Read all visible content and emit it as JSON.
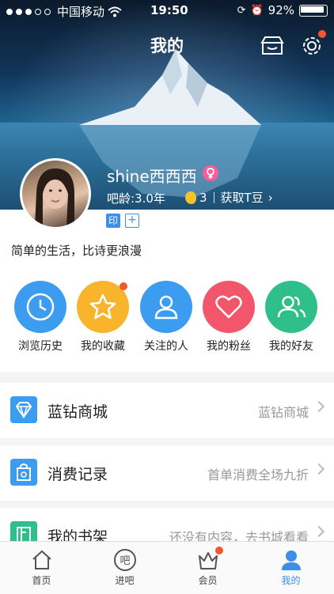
{
  "status": {
    "carrier": "中国移动",
    "time": "19:50",
    "battery": "92%"
  },
  "header": {
    "title": "我的"
  },
  "profile": {
    "username": "shine西西西",
    "age": "吧龄:3.0年",
    "beans_count": "3",
    "get_beans": "获取T豆",
    "badge_print": "印",
    "badge_add": "+",
    "bio": "简单的生活，比诗更浪漫"
  },
  "quick": [
    {
      "label": "浏览历史",
      "color": "#3c9df0"
    },
    {
      "label": "我的收藏",
      "color": "#f8b52b"
    },
    {
      "label": "关注的人",
      "color": "#3c9df0"
    },
    {
      "label": "我的粉丝",
      "color": "#f2566b"
    },
    {
      "label": "我的好友",
      "color": "#2fbf8a"
    }
  ],
  "menu": [
    {
      "title": "蓝钻商城",
      "right": "蓝钻商城",
      "icon": "diamond-icon",
      "color": "#3c9df0"
    },
    {
      "title": "消费记录",
      "right": "首单消费全场九折",
      "icon": "shopping-bag-icon",
      "color": "#3c9df0"
    },
    {
      "title": "我的书架",
      "right": "还没有内容，去书城看看",
      "icon": "bookshelf-icon",
      "color": "#2fbf8a"
    }
  ],
  "tabs": [
    {
      "label": "首页",
      "icon": "home-icon"
    },
    {
      "label": "进吧",
      "icon": "ba-icon"
    },
    {
      "label": "会员",
      "icon": "crown-icon"
    },
    {
      "label": "我的",
      "icon": "profile-icon"
    }
  ],
  "colors": {
    "accent": "#3c8ee8",
    "notify": "#f5552a"
  }
}
